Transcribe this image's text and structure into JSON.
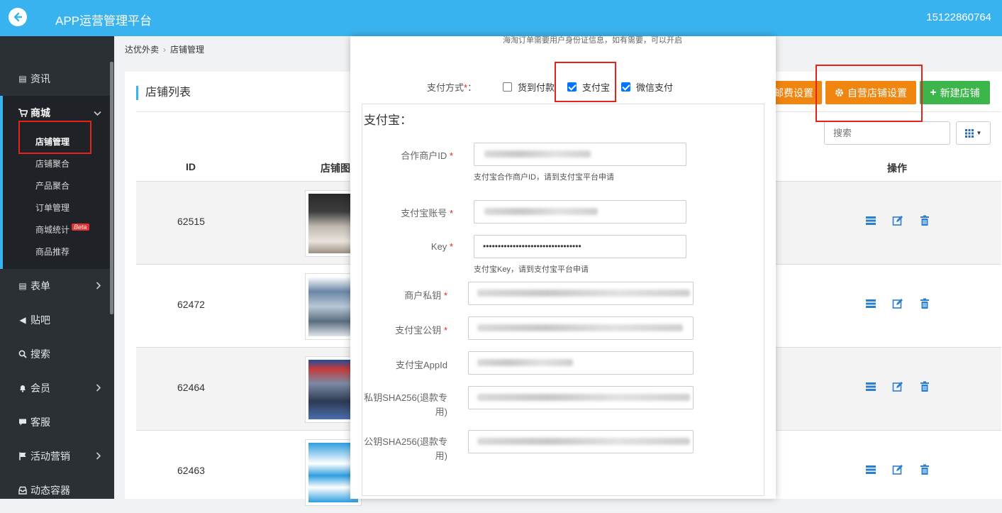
{
  "app": {
    "title": "APP运营管理平台",
    "user": "15122860764"
  },
  "sidebar": {
    "items": [
      {
        "label": "资讯",
        "icon": "list-icon"
      },
      {
        "label": "商城",
        "icon": "cart-icon"
      },
      {
        "label": "表单",
        "icon": "form-icon"
      },
      {
        "label": "贴吧",
        "icon": "megaphone-icon"
      },
      {
        "label": "搜索",
        "icon": "search-icon"
      },
      {
        "label": "会员",
        "icon": "bell-icon"
      },
      {
        "label": "客服",
        "icon": "chat-icon"
      },
      {
        "label": "活动营销",
        "icon": "flag-icon"
      },
      {
        "label": "动态容器",
        "icon": "inbox-icon"
      }
    ],
    "sub_items": [
      "店铺管理",
      "店铺聚合",
      "产品聚合",
      "订单管理",
      "商城统计",
      "商品推荐"
    ],
    "beta": "Beta"
  },
  "breadcrumb": {
    "root": "达优外卖",
    "current": "店铺管理"
  },
  "panel": {
    "title": "店铺列表",
    "buttons": {
      "postage": "邮费设置",
      "self_store": "自营店铺设置",
      "new_store": "新建店铺"
    },
    "search_placeholder": "搜索",
    "columns": {
      "id": "ID",
      "image": "店铺图",
      "ops": "操作"
    },
    "rows": [
      {
        "id": "62515"
      },
      {
        "id": "62472"
      },
      {
        "id": "62464"
      },
      {
        "id": "62463"
      }
    ]
  },
  "modal": {
    "note": "海淘订单需要用户身份证信息，如有需要，可以开启",
    "pay_label": "支付方式",
    "pay_options": [
      {
        "label": "货到付款",
        "checked": false
      },
      {
        "label": "支付宝",
        "checked": true
      },
      {
        "label": "微信支付",
        "checked": true
      }
    ],
    "alipay": {
      "title": "支付宝：",
      "fields": {
        "partner_id": "合作商户ID",
        "partner_hint": "支付宝合作商户ID，请到支付宝平台申请",
        "account": "支付宝账号",
        "key": "Key",
        "key_value": "•••••••••••••••••••••••••••••••••",
        "key_hint": "支付宝Key，请到支付宝平台申请",
        "private_key": "商户私钥",
        "public_key": "支付宝公钥",
        "appid": "支付宝AppId",
        "private_sha": "私钥SHA256(退款专用)",
        "public_sha": "公钥SHA256(退款专用)"
      }
    }
  }
}
